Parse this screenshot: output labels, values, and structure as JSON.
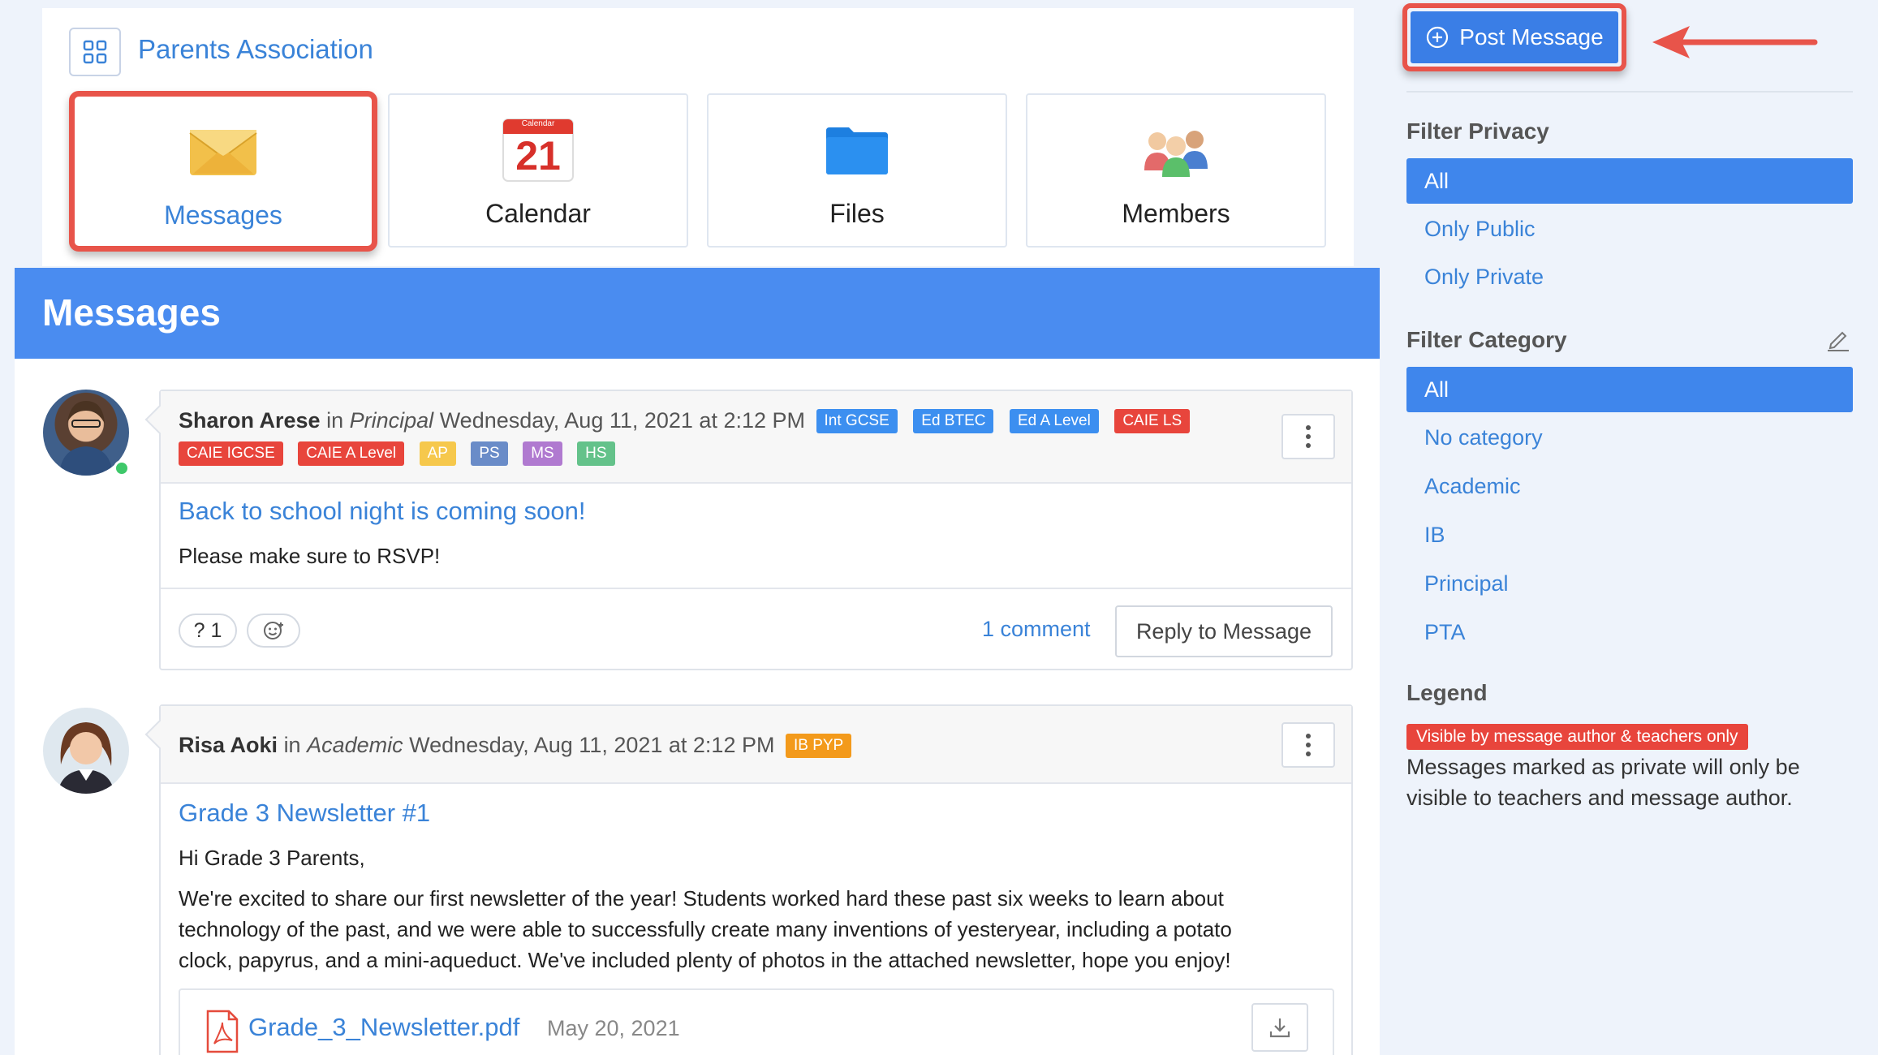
{
  "group": {
    "title": "Parents Association",
    "icon": "grid-icon"
  },
  "tiles": [
    {
      "label": "Messages",
      "icon": "envelope-icon",
      "active": true
    },
    {
      "label": "Calendar",
      "icon": "calendar-icon",
      "day": "21",
      "month_label": "Calendar"
    },
    {
      "label": "Files",
      "icon": "folder-icon"
    },
    {
      "label": "Members",
      "icon": "people-icon"
    }
  ],
  "section_title": "Messages",
  "messages": [
    {
      "author": "Sharon Arese",
      "in_word": "in",
      "category": "Principal",
      "date": "Wednesday, Aug 11, 2021 at 2:12 PM",
      "tags": [
        "Int GCSE",
        "Ed BTEC",
        "Ed A Level",
        "CAIE LS",
        "CAIE IGCSE",
        "CAIE A Level",
        "AP",
        "PS",
        "MS",
        "HS"
      ],
      "title": "Back to school night is coming soon!",
      "body": "Please make sure to RSVP!",
      "reaction": "? 1",
      "comments": "1 comment",
      "reply_label": "Reply to Message",
      "online": true
    },
    {
      "author": "Risa Aoki",
      "in_word": "in",
      "category": "Academic",
      "date": "Wednesday, Aug 11, 2021 at 2:12 PM",
      "tags": [
        "IB PYP"
      ],
      "title": "Grade 3 Newsletter #1",
      "greeting": "Hi Grade 3 Parents,",
      "body_lines": [
        "We're excited to share our first newsletter of the year! Students worked hard these past six weeks to learn about",
        "technology of the past, and we were able to successfully create many inventions of yesteryear, including a potato",
        "clock, papyrus, and a mini-aqueduct. We've included plenty of photos in the attached newsletter, hope you enjoy!"
      ],
      "attachment": {
        "name": "Grade_3_Newsletter.pdf",
        "date": "May 20, 2021"
      }
    }
  ],
  "sidebar": {
    "post_label": "Post Message",
    "filter_privacy": {
      "heading": "Filter Privacy",
      "options": [
        "All",
        "Only Public",
        "Only Private"
      ],
      "selected": "All"
    },
    "filter_category": {
      "heading": "Filter Category",
      "options": [
        "All",
        "No category",
        "Academic",
        "IB",
        "Principal",
        "PTA"
      ],
      "selected": "All"
    },
    "legend": {
      "heading": "Legend",
      "badge": "Visible by message author & teachers only",
      "text": "Messages marked as private will only be visible to teachers and message author."
    }
  },
  "colors": {
    "accent": "#3a83d8",
    "bar": "#4a8cf0",
    "highlight": "#e8544a",
    "online": "#3ec86a"
  }
}
